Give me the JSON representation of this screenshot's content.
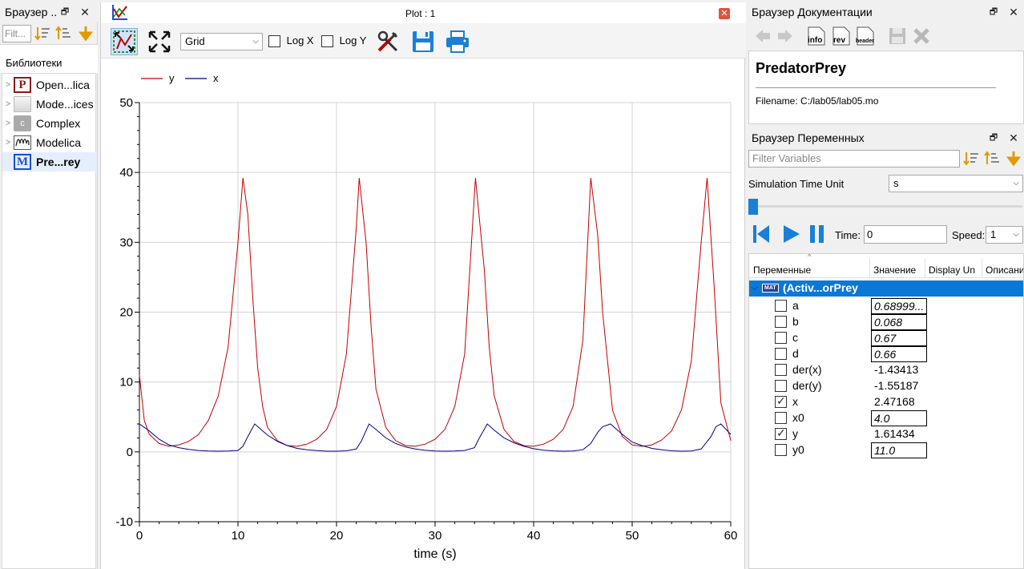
{
  "left_panel": {
    "title": "Браузер ..",
    "filter_placeholder": "Filt...",
    "libraries_label": "Библиотеки",
    "items": [
      {
        "label": "Open...lica",
        "icon": "P"
      },
      {
        "label": "Mode...ices",
        "icon": ""
      },
      {
        "label": "Complex",
        "icon": "c"
      },
      {
        "label": "Modelica",
        "icon": ""
      },
      {
        "label": "Pre...rey",
        "icon": "M"
      }
    ]
  },
  "plot_window": {
    "title": "Plot : 1",
    "grid_combo": "Grid",
    "logx_label": "Log X",
    "logy_label": "Log Y",
    "legend": [
      {
        "name": "y",
        "color": "#c00000"
      },
      {
        "name": "x",
        "color": "#00008b"
      }
    ],
    "xlabel": "time (s)"
  },
  "chart_data": {
    "type": "line",
    "xlabel": "time (s)",
    "ylabel": "",
    "xlim": [
      0,
      60
    ],
    "ylim": [
      -10,
      50
    ],
    "xticks": [
      0,
      10,
      20,
      30,
      40,
      50,
      60
    ],
    "yticks": [
      -10,
      0,
      10,
      20,
      30,
      40,
      50
    ],
    "grid": true,
    "legend_position": "top-left",
    "series": [
      {
        "name": "y",
        "color": "#c00000",
        "x": [
          0,
          0.5,
          1,
          2,
          3,
          4,
          5,
          6,
          7,
          8,
          9,
          10,
          10.5,
          11,
          11.5,
          12,
          12.5,
          13,
          14,
          15,
          16,
          17,
          18,
          19,
          20,
          21,
          22,
          22.3,
          23,
          23.5,
          24,
          25,
          26,
          27,
          28,
          29,
          30,
          31,
          32,
          33,
          34,
          34.1,
          35,
          35.5,
          36,
          37,
          38,
          39,
          40,
          41,
          42,
          43,
          44,
          45,
          45.8,
          46.5,
          47,
          48,
          49,
          50,
          51,
          52,
          53,
          54,
          55,
          56,
          57,
          57.6,
          58.3,
          59,
          60
        ],
        "y": [
          11,
          4.5,
          2.5,
          1.2,
          0.8,
          1.0,
          1.5,
          2.5,
          4.5,
          8,
          15,
          30,
          39.2,
          34,
          22,
          12,
          6.5,
          3.5,
          1.6,
          0.9,
          0.8,
          1.1,
          1.8,
          3.2,
          6.5,
          14,
          32,
          39.2,
          30,
          18,
          9,
          3.5,
          1.6,
          0.9,
          0.8,
          1.1,
          1.8,
          3.2,
          6.5,
          14,
          37,
          39.2,
          26,
          15,
          8,
          3.2,
          1.5,
          0.9,
          0.8,
          1.1,
          1.8,
          3.2,
          6.5,
          16,
          39.2,
          31,
          20,
          6,
          2.2,
          1.0,
          0.8,
          1.0,
          1.7,
          3.0,
          6,
          13,
          30,
          39.2,
          24,
          7,
          1.6
        ]
      },
      {
        "name": "x",
        "color": "#00008b",
        "x": [
          0,
          1,
          2,
          3,
          4,
          5,
          6,
          7,
          8,
          9,
          10,
          10.5,
          11,
          11.7,
          12.5,
          13,
          14,
          15,
          16,
          17,
          18,
          19,
          20,
          21,
          22,
          22.5,
          23.3,
          24,
          25,
          26,
          27,
          28,
          29,
          30,
          31,
          32,
          33,
          34,
          34.5,
          35.3,
          36,
          37,
          38,
          39,
          40,
          41,
          42,
          43,
          44,
          45,
          45.8,
          46.5,
          47,
          47.8,
          49,
          50,
          51,
          52,
          53,
          54,
          55,
          56,
          57,
          58,
          58.5,
          59,
          60
        ],
        "y": [
          4.0,
          3.0,
          1.8,
          1.0,
          0.6,
          0.35,
          0.2,
          0.12,
          0.1,
          0.12,
          0.2,
          0.8,
          2.2,
          4.0,
          3.0,
          2.4,
          1.5,
          0.9,
          0.5,
          0.3,
          0.18,
          0.1,
          0.1,
          0.15,
          0.4,
          1.5,
          4.0,
          3.2,
          2.0,
          1.2,
          0.7,
          0.4,
          0.22,
          0.12,
          0.1,
          0.12,
          0.2,
          0.6,
          2.0,
          4.0,
          3.1,
          2.0,
          1.3,
          0.8,
          0.45,
          0.25,
          0.14,
          0.1,
          0.12,
          0.3,
          1.2,
          2.8,
          3.6,
          4.0,
          2.5,
          1.4,
          0.9,
          0.5,
          0.3,
          0.15,
          0.1,
          0.12,
          0.4,
          2.2,
          3.6,
          4.0,
          2.5
        ]
      }
    ]
  },
  "doc_browser": {
    "title": "Браузер Документации",
    "model_name": "PredatorPrey",
    "filename_label": "Filename: C:/lab05/lab05.mo",
    "btn_info": "info",
    "btn_rev": "rev",
    "btn_header": "header"
  },
  "var_browser": {
    "title": "Браузер Переменных",
    "filter_placeholder": "Filter Variables",
    "sim_time_unit_label": "Simulation Time Unit",
    "sim_time_unit_value": "s",
    "time_label": "Time:",
    "time_value": "0",
    "speed_label": "Speed:",
    "speed_value": "1",
    "slider_position": 0,
    "columns": [
      "Переменные",
      "Значение",
      "Display Un",
      "Описани"
    ],
    "root_label": "(Activ...orPrey",
    "root_badge": "MAT",
    "variables": [
      {
        "name": "a",
        "value": "0.68999...",
        "editable": true,
        "checked": false
      },
      {
        "name": "b",
        "value": "0.068",
        "editable": true,
        "checked": false
      },
      {
        "name": "c",
        "value": "0.67",
        "editable": true,
        "checked": false
      },
      {
        "name": "d",
        "value": "0.66",
        "editable": true,
        "checked": false
      },
      {
        "name": "der(x)",
        "value": "-1.43413",
        "editable": false,
        "checked": false
      },
      {
        "name": "der(y)",
        "value": "-1.55187",
        "editable": false,
        "checked": false
      },
      {
        "name": "x",
        "value": "2.47168",
        "editable": false,
        "checked": true
      },
      {
        "name": "x0",
        "value": "4.0",
        "editable": true,
        "checked": false
      },
      {
        "name": "y",
        "value": "1.61434",
        "editable": false,
        "checked": true
      },
      {
        "name": "y0",
        "value": "11.0",
        "editable": true,
        "checked": false
      }
    ]
  }
}
